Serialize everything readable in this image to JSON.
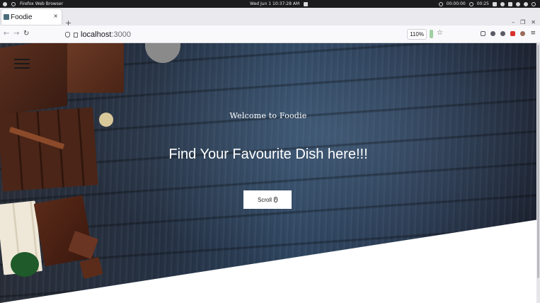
{
  "os": {
    "app_name": "Firefox Web Browser",
    "datetime": "Wed Jun 1  10:37:28 AM",
    "timer1": "00:00:00",
    "timer2": "00:25"
  },
  "browser": {
    "tab_title": "Foodie",
    "tab_close": "×",
    "new_tab": "+",
    "url_host": "localhost",
    "url_port": ":3000",
    "zoom": "110%",
    "back": "←",
    "forward": "→",
    "reload": "↻",
    "star": "☆",
    "menu": "≡",
    "minimize": "–",
    "restore": "❐",
    "close": "✕"
  },
  "hero": {
    "welcome": "Welcome to Foodie",
    "headline": "Find Your Favourite Dish here!!!",
    "scroll_label": "Scroll"
  },
  "colors": {
    "hero_bg": "#2a3a52",
    "button_bg": "#ffffff",
    "text": "#ffffff"
  }
}
